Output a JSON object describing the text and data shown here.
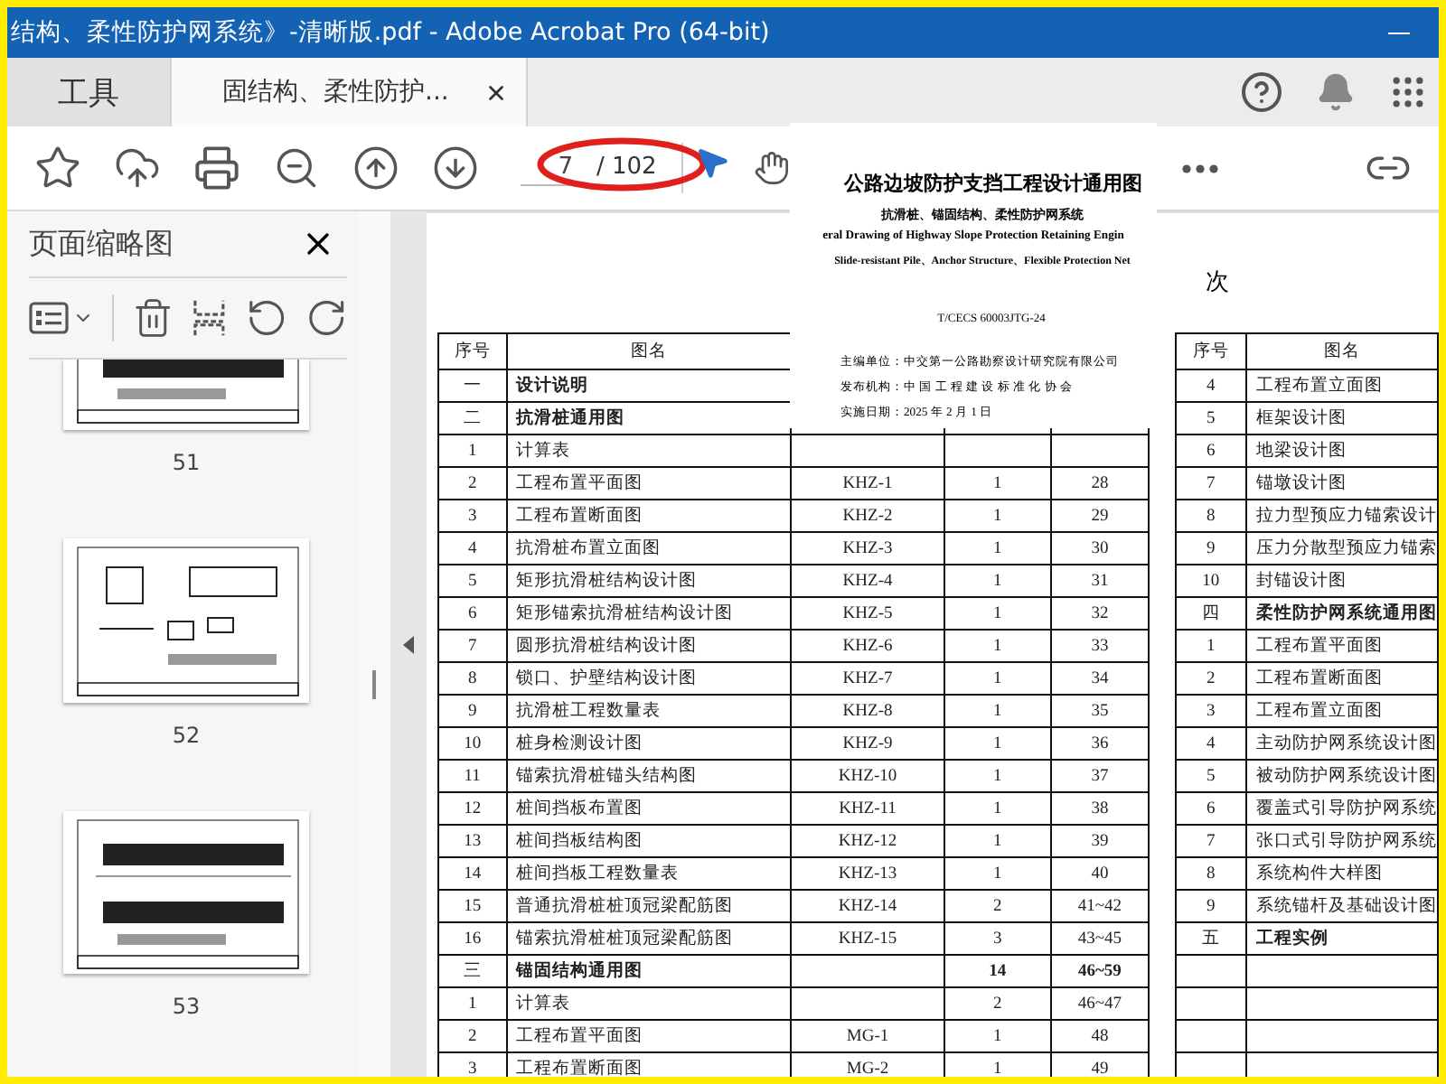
{
  "window": {
    "title": "结构、柔性防护网系统》-清晰版.pdf - Adobe Acrobat Pro (64-bit)"
  },
  "tabs": [
    {
      "label": "工具",
      "selected": false
    },
    {
      "label": "固结构、柔性防护...",
      "selected": true
    }
  ],
  "toolbar": {
    "page_number": "7",
    "page_total": "/ 102"
  },
  "sidebar": {
    "title": "页面缩略图",
    "thumbnails": [
      {
        "page": "51",
        "kind": "beams",
        "cut_off": true
      },
      {
        "page": "52",
        "kind": "detail",
        "cut_off": false
      },
      {
        "page": "53",
        "kind": "beams",
        "cut_off": false
      }
    ]
  },
  "cover": {
    "title": "公路边坡防护支挡工程设计通用图",
    "subtitle": "抗滑桩、锚固结构、柔性防护网系统",
    "english_title": "eral Drawing of Highway Slope Protection Retaining Engin",
    "english_subtitle": "Slide-resistant Pile、Anchor Structure、Flexible Protection Net",
    "code": "T/CECS 60003JTG-24",
    "lines": [
      "主编单位：中交第一公路勘察设计研究院有限公司",
      "发布机构：中 国 工 程 建 设 标 准 化 协 会",
      "实施日期：2025 年 2 月 1 日"
    ]
  },
  "document": {
    "heading": "次",
    "left_table": {
      "columns": [
        "序号",
        "图名"
      ],
      "rows": [
        {
          "no": "一",
          "name": "设计说明",
          "kind": "section"
        },
        {
          "no": "二",
          "name": "抗滑桩通用图",
          "kind": "section"
        },
        {
          "no": "1",
          "name": "计算表",
          "kind": "item"
        },
        {
          "no": "2",
          "name": "工程布置平面图",
          "code": "KHZ-1",
          "sheets": "1",
          "pages": "28",
          "kind": "item"
        },
        {
          "no": "3",
          "name": "工程布置断面图",
          "code": "KHZ-2",
          "sheets": "1",
          "pages": "29",
          "kind": "item"
        },
        {
          "no": "4",
          "name": "抗滑桩布置立面图",
          "code": "KHZ-3",
          "sheets": "1",
          "pages": "30",
          "kind": "item"
        },
        {
          "no": "5",
          "name": "矩形抗滑桩结构设计图",
          "code": "KHZ-4",
          "sheets": "1",
          "pages": "31",
          "kind": "item"
        },
        {
          "no": "6",
          "name": "矩形锚索抗滑桩结构设计图",
          "code": "KHZ-5",
          "sheets": "1",
          "pages": "32",
          "kind": "item"
        },
        {
          "no": "7",
          "name": "圆形抗滑桩结构设计图",
          "code": "KHZ-6",
          "sheets": "1",
          "pages": "33",
          "kind": "item"
        },
        {
          "no": "8",
          "name": "锁口、护壁结构设计图",
          "code": "KHZ-7",
          "sheets": "1",
          "pages": "34",
          "kind": "item"
        },
        {
          "no": "9",
          "name": "抗滑桩工程数量表",
          "code": "KHZ-8",
          "sheets": "1",
          "pages": "35",
          "kind": "item"
        },
        {
          "no": "10",
          "name": "桩身检测设计图",
          "code": "KHZ-9",
          "sheets": "1",
          "pages": "36",
          "kind": "item"
        },
        {
          "no": "11",
          "name": "锚索抗滑桩锚头结构图",
          "code": "KHZ-10",
          "sheets": "1",
          "pages": "37",
          "kind": "item"
        },
        {
          "no": "12",
          "name": "桩间挡板布置图",
          "code": "KHZ-11",
          "sheets": "1",
          "pages": "38",
          "kind": "item"
        },
        {
          "no": "13",
          "name": "桩间挡板结构图",
          "code": "KHZ-12",
          "sheets": "1",
          "pages": "39",
          "kind": "item"
        },
        {
          "no": "14",
          "name": "桩间挡板工程数量表",
          "code": "KHZ-13",
          "sheets": "1",
          "pages": "40",
          "kind": "item"
        },
        {
          "no": "15",
          "name": "普通抗滑桩桩顶冠梁配筋图",
          "code": "KHZ-14",
          "sheets": "2",
          "pages": "41~42",
          "kind": "item"
        },
        {
          "no": "16",
          "name": "锚索抗滑桩桩顶冠梁配筋图",
          "code": "KHZ-15",
          "sheets": "3",
          "pages": "43~45",
          "kind": "item"
        },
        {
          "no": "三",
          "name": "锚固结构通用图",
          "sheets": "14",
          "pages": "46~59",
          "kind": "section"
        },
        {
          "no": "1",
          "name": "计算表",
          "sheets": "2",
          "pages": "46~47",
          "kind": "item"
        },
        {
          "no": "2",
          "name": "工程布置平面图",
          "code": "MG-1",
          "sheets": "1",
          "pages": "48",
          "kind": "item"
        },
        {
          "no": "3",
          "name": "工程布置断面图",
          "code": "MG-2",
          "sheets": "1",
          "pages": "49",
          "kind": "item"
        }
      ]
    },
    "right_table": {
      "columns": [
        "序号",
        "图名"
      ],
      "rows": [
        {
          "no": "4",
          "name": "工程布置立面图",
          "kind": "item"
        },
        {
          "no": "5",
          "name": "框架设计图",
          "kind": "item"
        },
        {
          "no": "6",
          "name": "地梁设计图",
          "kind": "item"
        },
        {
          "no": "7",
          "name": "锚墩设计图",
          "kind": "item"
        },
        {
          "no": "8",
          "name": "拉力型预应力锚索设计",
          "kind": "item"
        },
        {
          "no": "9",
          "name": "压力分散型预应力锚索",
          "kind": "item"
        },
        {
          "no": "10",
          "name": "封锚设计图",
          "kind": "item"
        },
        {
          "no": "四",
          "name": "柔性防护网系统通用图",
          "kind": "section"
        },
        {
          "no": "1",
          "name": "工程布置平面图",
          "kind": "item"
        },
        {
          "no": "2",
          "name": "工程布置断面图",
          "kind": "item"
        },
        {
          "no": "3",
          "name": "工程布置立面图",
          "kind": "item"
        },
        {
          "no": "4",
          "name": "主动防护网系统设计图",
          "kind": "item"
        },
        {
          "no": "5",
          "name": "被动防护网系统设计图",
          "kind": "item"
        },
        {
          "no": "6",
          "name": "覆盖式引导防护网系统",
          "kind": "item"
        },
        {
          "no": "7",
          "name": "张口式引导防护网系统",
          "kind": "item"
        },
        {
          "no": "8",
          "name": "系统构件大样图",
          "kind": "item"
        },
        {
          "no": "9",
          "name": "系统锚杆及基础设计图",
          "kind": "item"
        },
        {
          "no": "五",
          "name": "工程实例",
          "kind": "section"
        }
      ]
    }
  }
}
